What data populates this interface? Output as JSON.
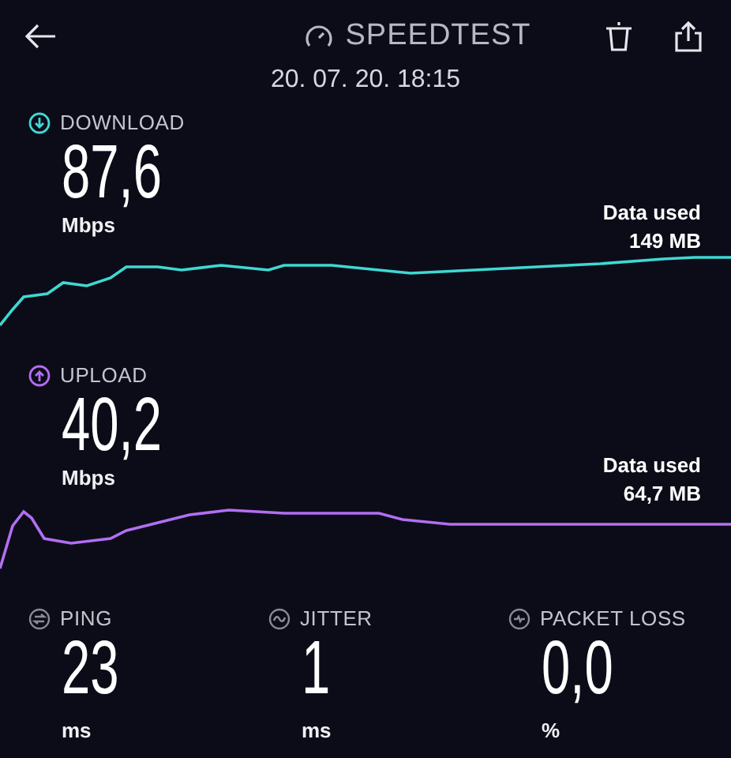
{
  "header": {
    "title": "SPEEDTEST",
    "datetime": "20. 07. 20. 18:15"
  },
  "sections": [
    {
      "kind": "download",
      "label": "DOWNLOAD",
      "value": "87,6",
      "unit": "Mbps",
      "data_label": "Data used",
      "data_value": "149 MB",
      "color": "#3fd8d2"
    },
    {
      "kind": "upload",
      "label": "UPLOAD",
      "value": "40,2",
      "unit": "Mbps",
      "data_label": "Data used",
      "data_value": "64,7 MB",
      "color": "#b36ef2"
    }
  ],
  "metrics": [
    {
      "kind": "ping",
      "label": "PING",
      "value": "23",
      "unit": "ms"
    },
    {
      "kind": "jitter",
      "label": "JITTER",
      "value": "1",
      "unit": "ms"
    },
    {
      "kind": "packet_loss",
      "label": "PACKET LOSS",
      "value": "0,0",
      "unit": "%"
    }
  ]
}
